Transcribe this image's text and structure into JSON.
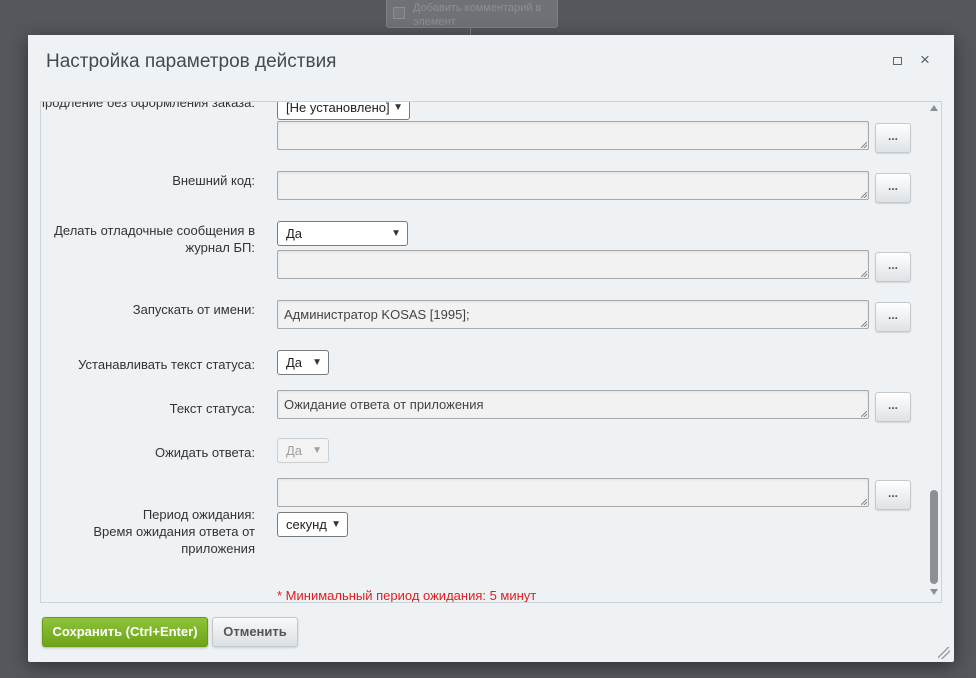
{
  "background_node": {
    "text": "Добавить комментарий в элемент"
  },
  "dialog": {
    "title": "Настройка параметров действия",
    "maximize_icon": "maximize-icon",
    "close_icon": "close-icon",
    "close_glyph": "×"
  },
  "form": {
    "row1": {
      "label": "Продление без оформления заказа:",
      "select_value": "[Не установлено]",
      "textarea_value": "",
      "button": "..."
    },
    "row2": {
      "label": "Внешний код:",
      "textarea_value": "",
      "button": "..."
    },
    "row3": {
      "label": "Делать отладочные сообщения в журнал БП:",
      "select_value": "Да",
      "textarea_value": "",
      "button": "..."
    },
    "row4": {
      "label": "Запускать от имени:",
      "textarea_value": "Администратор KOSAS [1995];",
      "button": "..."
    },
    "row5": {
      "label": "Устанавливать текст статуса:",
      "select_value": "Да"
    },
    "row6": {
      "label": "Текст статуса:",
      "textarea_value": "Ожидание ответа от приложения",
      "button": "..."
    },
    "row7": {
      "label": "Ожидать ответа:",
      "select_value": "Да",
      "disabled": true
    },
    "row8": {
      "label": "Период ожидания:\nВремя ожидания ответа от приложения",
      "label_line1": "Период ожидания:",
      "label_line2": "Время ожидания ответа от приложения",
      "textarea_value": "",
      "button": "...",
      "select_value": "секунд",
      "hint": "* Минимальный период ожидания: 5 минут"
    }
  },
  "footer": {
    "save_label": "Сохранить (Ctrl+Enter)",
    "cancel_label": "Отменить"
  },
  "colors": {
    "save_button": "#7ab32a",
    "hint_text": "#e11d1d",
    "overlay": "#54585d"
  }
}
